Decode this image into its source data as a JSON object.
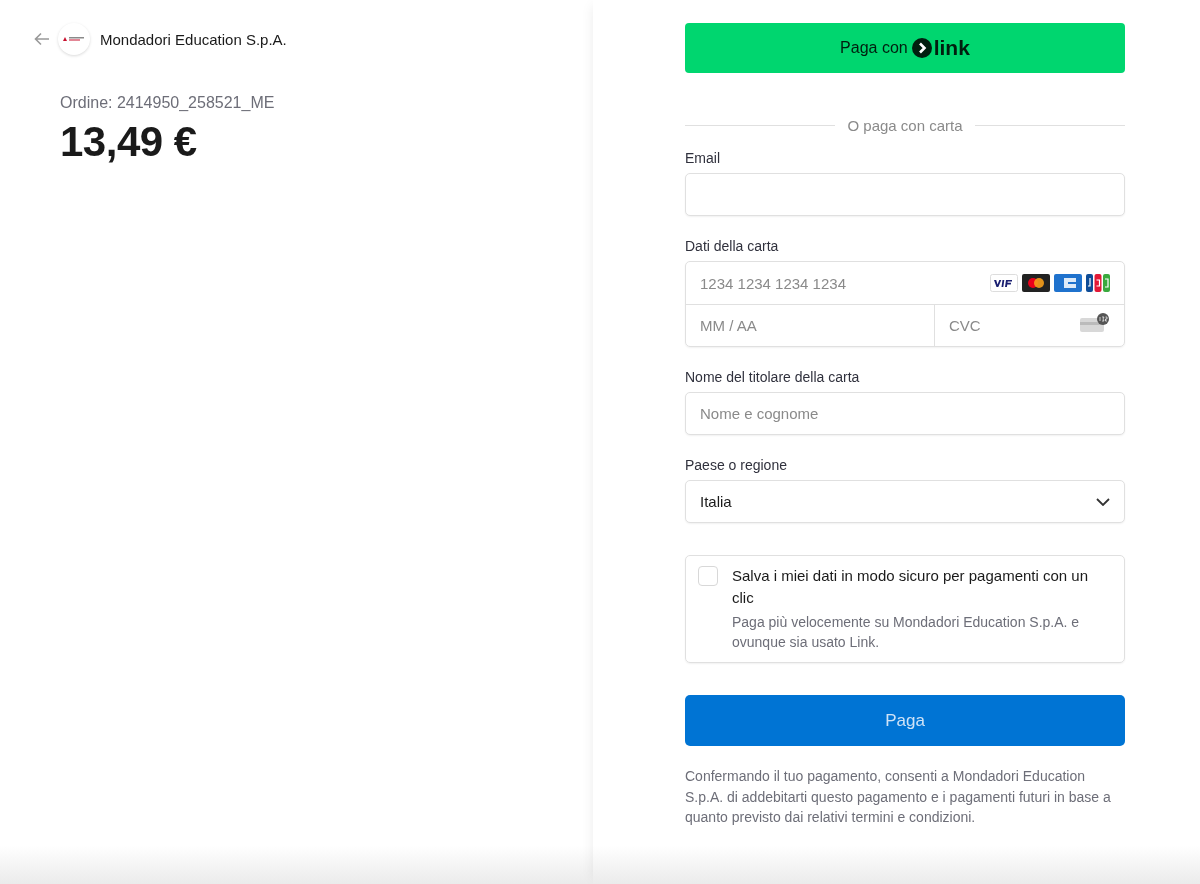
{
  "merchant": {
    "name": "Mondadori Education S.p.A."
  },
  "order": {
    "label": "Ordine: 2414950_258521_ME",
    "amount": "13,49 €"
  },
  "link_button": {
    "label": "Paga con",
    "brand": "link"
  },
  "divider": "O paga con carta",
  "fields": [
    {
      "kind": "text",
      "label": "Email"
    },
    {
      "kind": "card",
      "label": "Dati della carta",
      "number_placeholder": "1234 1234 1234 1234",
      "expiry_placeholder": "MM / AA",
      "cvc_placeholder": "CVC"
    },
    {
      "kind": "text",
      "label": "Nome del titolare della carta",
      "placeholder": "Nome e cognome"
    },
    {
      "kind": "select",
      "label": "Paese o regione",
      "value": "Italia"
    }
  ],
  "save_option": {
    "checked": false,
    "title": "Salva i miei dati in modo sicuro per pagamenti con un clic",
    "description": "Paga più velocemente su Mondadori Education S.p.A. e ovunque sia usato Link."
  },
  "pay_button": {
    "label": "Paga"
  },
  "legal": "Confermando il tuo pagamento, consenti a Mondadori Education S.p.A. di addebitarti questo pagamento e i pagamenti futuri in base a quanto previsto dai relativi termini e condizioni."
}
